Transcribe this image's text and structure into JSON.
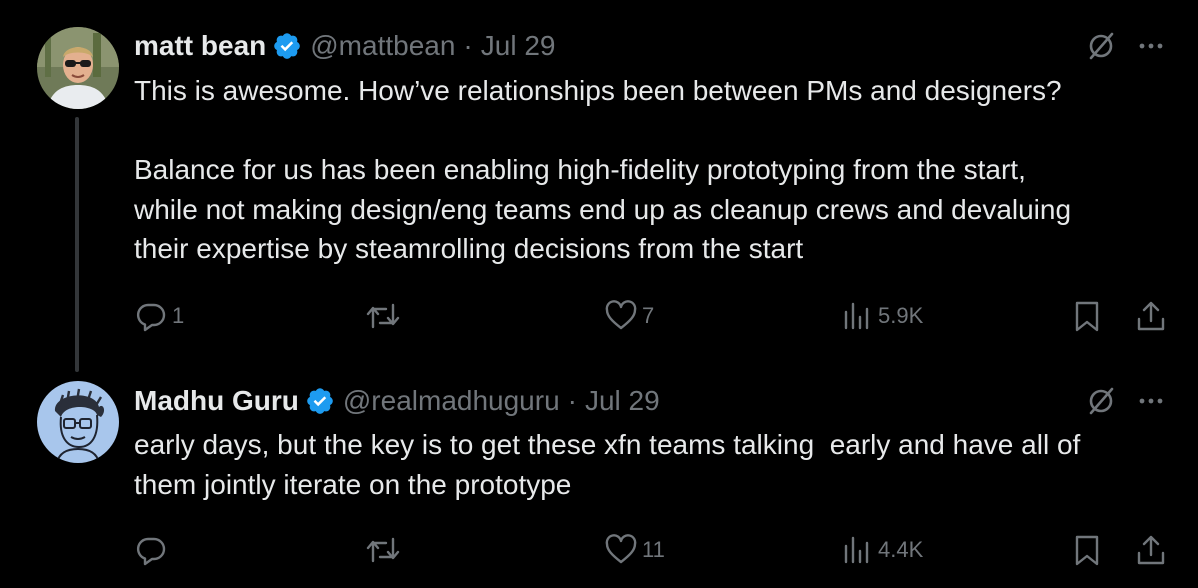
{
  "tweets": [
    {
      "author_name": "matt bean",
      "handle": "@mattbean",
      "separator": "·",
      "date": "Jul 29",
      "text": [
        "This is awesome. How’ve relationships been between PMs and designers?",
        "",
        "Balance for us has been enabling high-fidelity prototyping from the start,",
        "while not making design/eng teams end up as cleanup crews and devaluing",
        "their expertise by steamrolling decisions from the start"
      ],
      "replies": "1",
      "retweets": "",
      "likes": "7",
      "views": "5.9K"
    },
    {
      "author_name": "Madhu Guru",
      "handle": "@realmadhuguru",
      "separator": "·",
      "date": "Jul 29",
      "text": [
        "early days, but the key is to get these xfn teams talking  early and have all of",
        "them jointly iterate on the prototype"
      ],
      "replies": "",
      "retweets": "",
      "likes": "11",
      "views": "4.4K"
    }
  ],
  "icons": {
    "verified": "verified-badge-icon",
    "grok": "grok-icon",
    "more": "more-icon",
    "reply": "reply-icon",
    "retweet": "retweet-icon",
    "like": "like-icon",
    "views": "views-icon",
    "bookmark": "bookmark-icon",
    "share": "share-icon"
  },
  "colors": {
    "background": "#000000",
    "text": "#e7e9ea",
    "secondary": "#71767b",
    "verified": "#1d9bf0",
    "connector": "#333639"
  }
}
